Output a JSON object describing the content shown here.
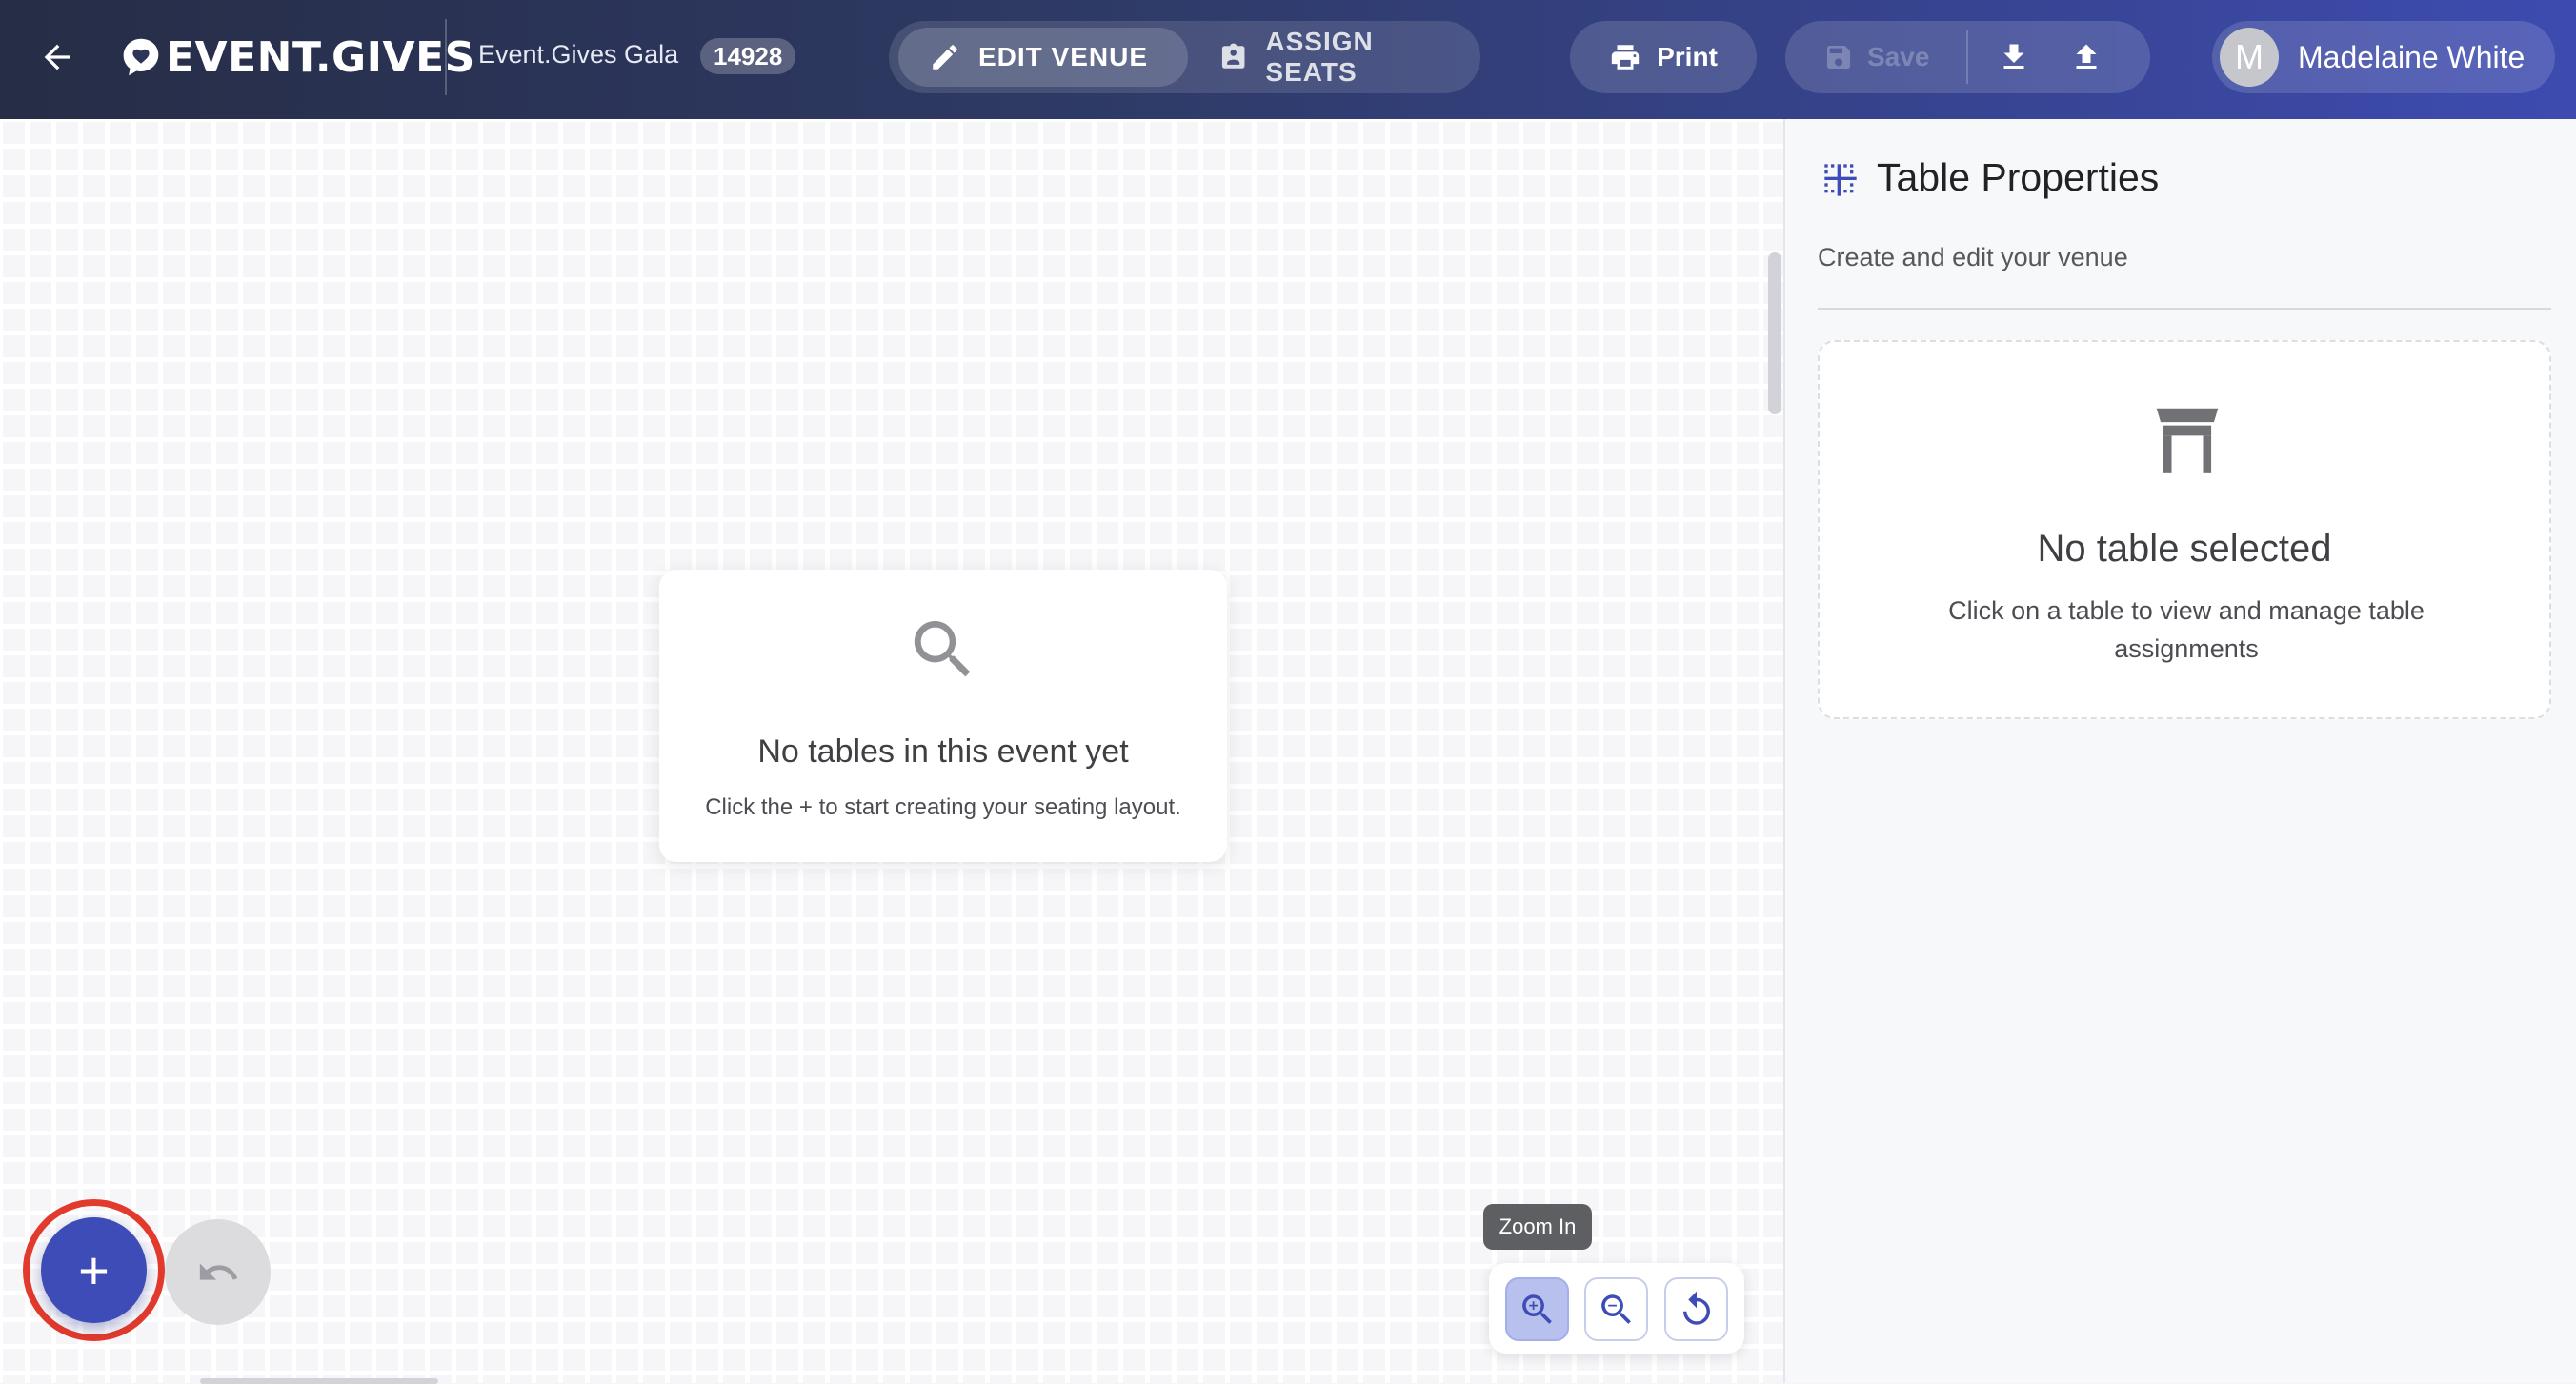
{
  "app": {
    "logo": "EVENT.GIVES"
  },
  "header": {
    "event_name": "Event.Gives Gala",
    "event_id": "14928",
    "modes": {
      "edit_venue": "EDIT VENUE",
      "assign_seats": "ASSIGN SEATS"
    },
    "print_label": "Print",
    "save_label": "Save",
    "user": {
      "name": "Madelaine White",
      "initial": "M"
    }
  },
  "canvas": {
    "empty_title": "No tables in this event yet",
    "empty_subtitle": "Click the + to start creating your seating layout.",
    "add_button": "+",
    "zoom_tooltip": "Zoom In"
  },
  "panel": {
    "title": "Table Properties",
    "subtitle": "Create and edit your venue",
    "empty_title": "No table selected",
    "empty_description": "Click on a table to view and manage table assignments"
  },
  "icons": {
    "back": "arrow-left-icon",
    "logo": "heart-logo-icon",
    "edit": "pencil-icon",
    "assign": "badge-icon",
    "print": "printer-icon",
    "save": "floppy-icon",
    "download": "download-icon",
    "upload": "upload-icon",
    "search": "search-icon",
    "undo": "undo-icon",
    "zoom_in": "zoom-in-icon",
    "zoom_out": "zoom-out-icon",
    "reset": "refresh-icon",
    "grid": "grid-icon",
    "table": "table-icon"
  },
  "colors": {
    "accent": "#3e4cb7",
    "highlight_ring": "#e23a2c",
    "header_start": "#262d46",
    "header_end": "#3d4bb0"
  }
}
